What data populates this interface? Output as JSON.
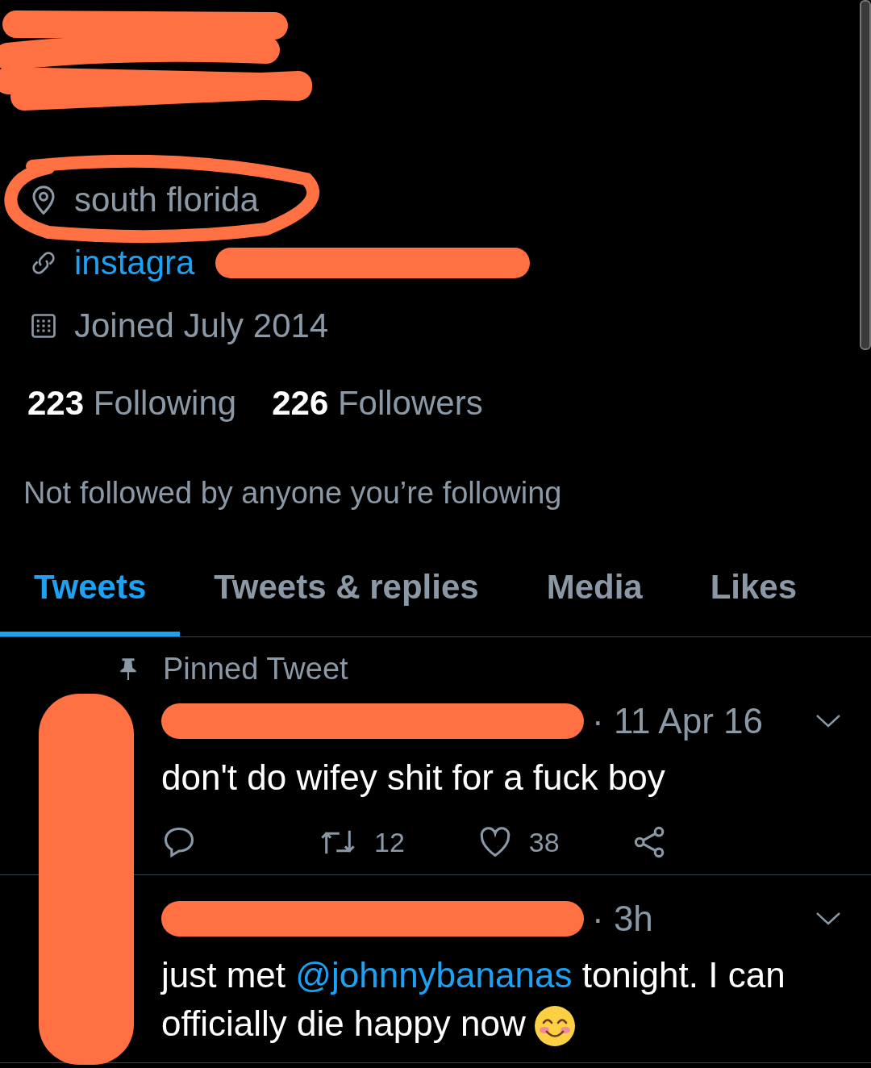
{
  "profile": {
    "location": "south florida",
    "link": "instagra",
    "joined": "Joined July 2014",
    "following_count": "223",
    "following_label": "Following",
    "followers_count": "226",
    "followers_label": "Followers",
    "followed_by": "Not followed by anyone you’re following"
  },
  "tabs": [
    {
      "label": "Tweets",
      "selected": true
    },
    {
      "label": "Tweets & replies",
      "selected": false
    },
    {
      "label": "Media",
      "selected": false
    },
    {
      "label": "Likes",
      "selected": false
    }
  ],
  "tweets": [
    {
      "pinned_label": "Pinned Tweet",
      "time": "· 11 Apr 16",
      "parts": [
        {
          "kind": "plain",
          "text": "don't do wifey shit for a fuck boy"
        }
      ],
      "retweets": "12",
      "likes": "38"
    },
    {
      "time": "· 3h",
      "parts": [
        {
          "kind": "plain",
          "text": "just met "
        },
        {
          "kind": "mention",
          "text": "@johnnybananas"
        },
        {
          "kind": "plain",
          "text": " tonight. I can officially die happy now"
        },
        {
          "kind": "emoji"
        }
      ]
    }
  ]
}
